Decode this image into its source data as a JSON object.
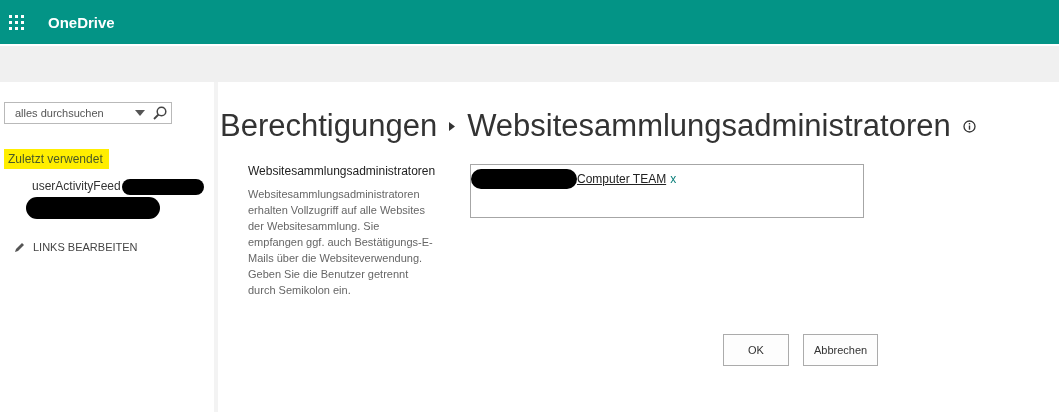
{
  "top_bar": {
    "app_name": "OneDrive"
  },
  "sidebar": {
    "search": {
      "placeholder": "alles durchsuchen"
    },
    "recent_heading": {
      "label": "Zuletzt verwendet",
      "highlighted": true
    },
    "recent_items": [
      {
        "label": "userActivityFeed",
        "redacted": true
      }
    ],
    "edit_links": {
      "label": "LINKS BEARBEITEN"
    }
  },
  "breadcrumb": [
    {
      "label": "Berechtigungen"
    },
    {
      "label": "Websitesammlungsadministratoren"
    }
  ],
  "section": {
    "heading": "Websitesammlungsadministratoren",
    "description": "Websitesammlungsadministratoren erhalten Vollzugriff auf alle Websites der Websitesammlung. Sie empfangen ggf. auch Bestätigungs-E-Mails über die Websiteverwendung. Geben Sie die Benutzer getrennt durch Semikolon ein.",
    "people": [
      {
        "name": "Computer TEAM",
        "remove": "x",
        "redacted": true
      }
    ]
  },
  "buttons": [
    {
      "label": "OK"
    },
    {
      "label": "Abbrechen"
    }
  ]
}
